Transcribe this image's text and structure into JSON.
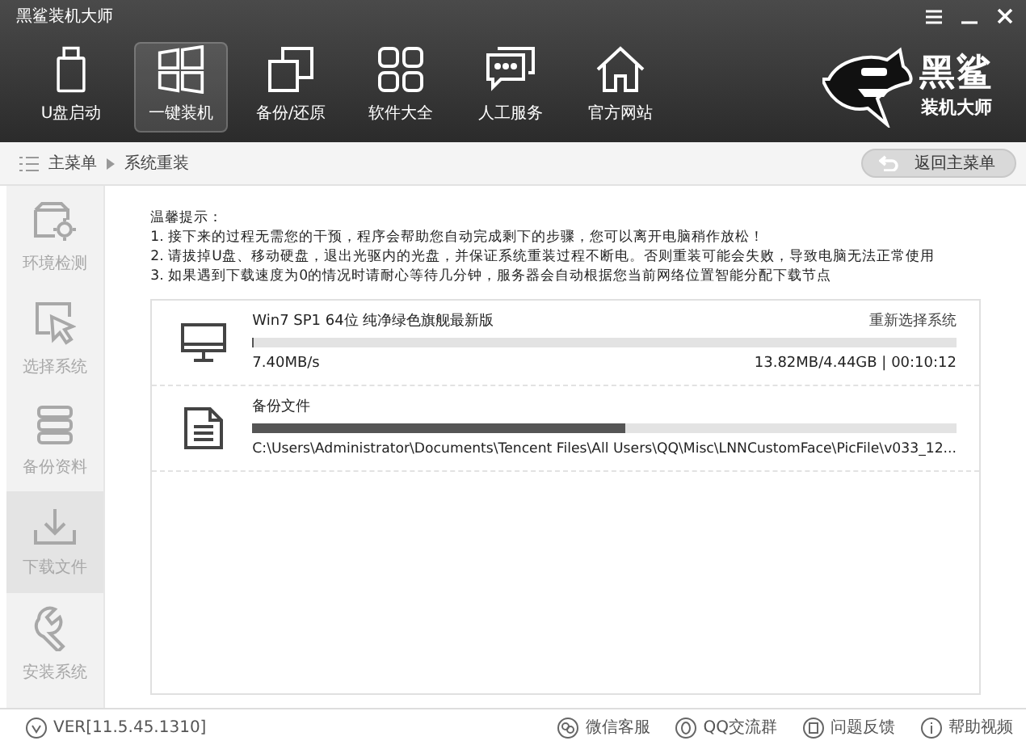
{
  "window": {
    "title": "黑鲨装机大师"
  },
  "toolbar": [
    {
      "label": "U盘启动",
      "selected": false
    },
    {
      "label": "一键装机",
      "selected": true
    },
    {
      "label": "备份/还原",
      "selected": false
    },
    {
      "label": "软件大全",
      "selected": false
    },
    {
      "label": "人工服务",
      "selected": false
    },
    {
      "label": "官方网站",
      "selected": false
    }
  ],
  "logo": {
    "name": "黑鲨",
    "tagline": "装机大师"
  },
  "breadcrumb": [
    "主菜单",
    "系统重装"
  ],
  "back_button": "返回主菜单",
  "sidebar": [
    {
      "label": "环境检测",
      "selected": false
    },
    {
      "label": "选择系统",
      "selected": false
    },
    {
      "label": "备份资料",
      "selected": false
    },
    {
      "label": "下载文件",
      "selected": true
    },
    {
      "label": "安装系统",
      "selected": false
    }
  ],
  "notice": {
    "title": "温馨提示：",
    "lines": [
      "1. 接下来的过程无需您的干预，程序会帮助您自动完成剩下的步骤，您可以离开电脑稍作放松！",
      "2. 请拔掉U盘、移动硬盘，退出光驱内的光盘，并保证系统重装过程不断电。否则重装可能会失败，导致电脑无法正常使用",
      "3. 如果遇到下载速度为0的情况时请耐心等待几分钟，服务器会自动根据您当前网络位置智能分配下载节点"
    ]
  },
  "downloads": [
    {
      "kind": "system",
      "name": "Win7 SP1 64位 纯净绿色旗舰最新版",
      "action": "重新选择系统",
      "level": 0.003,
      "speed": "7.40MB/s",
      "progress": "13.82MB/4.44GB | 00:10:12"
    },
    {
      "kind": "file",
      "name": "备份文件",
      "level": 0.53,
      "path": "C:\\Users\\Administrator\\Documents\\Tencent Files\\All Users\\QQ\\Misc\\LNNCustomFace\\PicFile\\v033_12..."
    }
  ],
  "footer": {
    "version": "VER[11.5.45.1310]",
    "links": [
      "微信客服",
      "QQ交流群",
      "问题反馈",
      "帮助视频"
    ]
  }
}
